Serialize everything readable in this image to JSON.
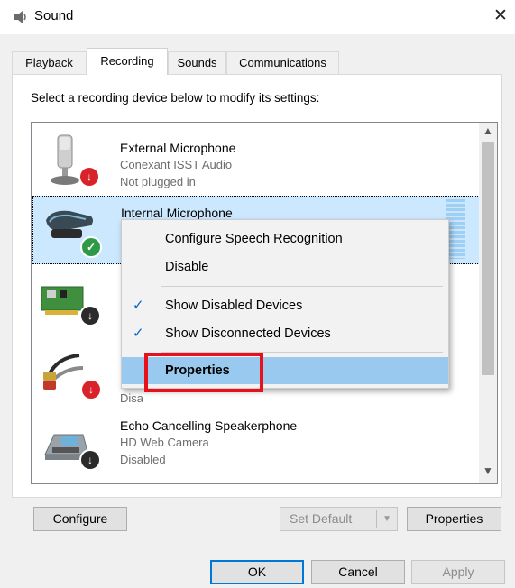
{
  "window": {
    "title": "Sound",
    "close_glyph": "✕"
  },
  "tabs": [
    {
      "label": "Playback"
    },
    {
      "label": "Recording",
      "selected": true
    },
    {
      "label": "Sounds"
    },
    {
      "label": "Communications"
    }
  ],
  "instruction": "Select a recording device below to modify its settings:",
  "devices": [
    {
      "name": "External Microphone",
      "driver": "Conexant ISST Audio",
      "status": "Not plugged in",
      "icon": "external-microphone-icon",
      "badge": "unplugged-badge"
    },
    {
      "name": "Internal Microphone",
      "driver": "",
      "status": "",
      "icon": "internal-microphone-icon",
      "badge": "default-device-badge",
      "selected": true
    },
    {
      "name": "",
      "driver": "",
      "status": "",
      "icon": "sound-card-icon",
      "badge": "disabled-badge"
    },
    {
      "name": "",
      "driver": "",
      "status": "Disa",
      "icon": "line-in-rca-icon",
      "badge": "unplugged-badge"
    },
    {
      "name": "Echo Cancelling Speakerphone",
      "driver": "HD Web Camera",
      "status": "Disabled",
      "icon": "speakerphone-icon",
      "badge": "disabled-badge"
    }
  ],
  "context_menu": {
    "items": [
      {
        "label": "Configure Speech Recognition"
      },
      {
        "label": "Disable"
      },
      {
        "label": "Show Disabled Devices",
        "checked": true
      },
      {
        "label": "Show Disconnected Devices",
        "checked": true
      },
      {
        "label": "Properties",
        "highlighted": true
      }
    ],
    "check_glyph": "✓"
  },
  "buttons": {
    "configure": "Configure",
    "set_default": "Set Default",
    "properties": "Properties",
    "ok": "OK",
    "cancel": "Cancel",
    "apply": "Apply"
  },
  "colors": {
    "selection": "#cce8ff",
    "menu_highlight": "#99c9ef",
    "annotation_box": "#e8101a",
    "default_badge": "#2e9a48",
    "unplugged_badge": "#d8232a",
    "disabled_badge": "#2b2b2b"
  }
}
